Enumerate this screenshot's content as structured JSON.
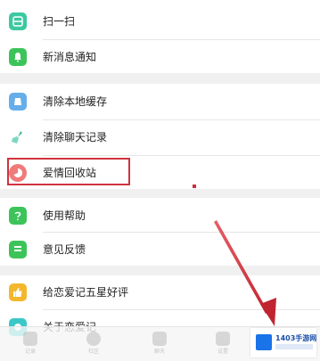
{
  "menu": {
    "group1": [
      {
        "label": "扫一扫",
        "icon": "scan-icon",
        "color": "#3cc8a0"
      },
      {
        "label": "新消息通知",
        "icon": "bell-icon",
        "color": "#3cc45a"
      }
    ],
    "group2": [
      {
        "label": "清除本地缓存",
        "icon": "cache-icon",
        "color": "#66aeea"
      },
      {
        "label": "清除聊天记录",
        "icon": "broom-icon",
        "color": "#4fb8a0"
      },
      {
        "label": "爱情回收站",
        "icon": "recycle-pie-icon",
        "color": "#f07a7a"
      }
    ],
    "group3": [
      {
        "label": "使用帮助",
        "icon": "question-icon",
        "color": "#3cc45a"
      },
      {
        "label": "意见反馈",
        "icon": "feedback-icon",
        "color": "#3cc45a"
      }
    ],
    "group4": [
      {
        "label": "给恋爱记五星好评",
        "icon": "thumbs-up-icon",
        "color": "#f2b72c"
      },
      {
        "label": "关于恋爱记",
        "icon": "about-icon",
        "color": "#3cc8c8"
      }
    ]
  },
  "tabbar": {
    "tabs": [
      {
        "label": "记录",
        "icon": "record-tab-icon"
      },
      {
        "label": "社区",
        "icon": "community-tab-icon"
      },
      {
        "label": "聊天",
        "icon": "chat-tab-icon"
      },
      {
        "label": "设置",
        "icon": "settings-tab-icon"
      }
    ]
  },
  "watermark": {
    "text": "1403手游网"
  },
  "annotation": {
    "box_color": "#d0343f",
    "arrow_color": "#d0343f"
  }
}
